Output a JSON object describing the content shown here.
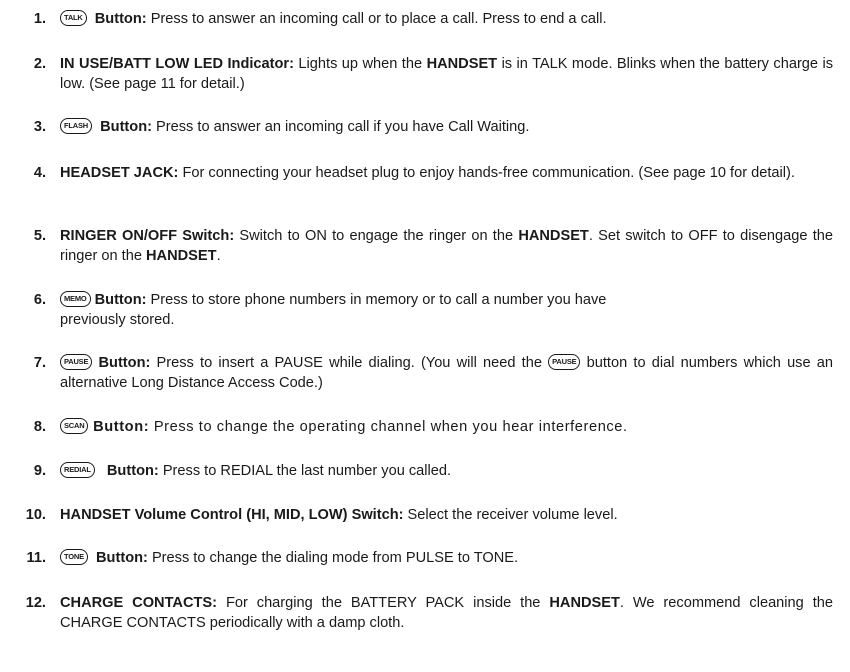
{
  "items": [
    {
      "num": "1.",
      "key": "TALK",
      "title": "Button:",
      "text": "Press to answer an incoming call or to place a call. Press to end a call."
    },
    {
      "num": "2.",
      "title": "IN USE/BATT LOW LED Indicator:",
      "text_a": "Lights up when the",
      "bold_a": "HANDSET",
      "text_b": "is in TALK mode. Blinks when the battery charge is low. (See page 11 for detail.)"
    },
    {
      "num": "3.",
      "key": "FLASH",
      "title": "Button:",
      "text": "Press to answer an incoming call if you have Call Waiting."
    },
    {
      "num": "4.",
      "title": "HEADSET JACK:",
      "text": "For connecting your headset plug to enjoy hands-free communication. (See page 10 for detail)."
    },
    {
      "num": "5.",
      "title": "RINGER ON/OFF Switch:",
      "text_a": "Switch to ON to engage the ringer on the",
      "bold_a": "HANDSET",
      "text_b": ". Set switch to OFF to disengage the ringer on the",
      "bold_b": "HANDSET",
      "text_c": "."
    },
    {
      "num": "6.",
      "key": "MEMO",
      "title": "Button:",
      "text_a": "Press to store phone numbers in memory or to call a number you have",
      "text_b": "previously stored."
    },
    {
      "num": "7.",
      "key": "PAUSE",
      "title": "Button:",
      "text_a": "Press to insert a PAUSE while dialing. (You will need the",
      "key2": "PAUSE",
      "text_b": "button to dial numbers which use an alternative Long Distance Access Code.)"
    },
    {
      "num": "8.",
      "key": "SCAN",
      "title": "Button:",
      "text": "Press to change the operating channel when you hear interference."
    },
    {
      "num": "9.",
      "key": "REDIAL",
      "title": "Button:",
      "text": "Press to REDIAL  the last number you called."
    },
    {
      "num": "10.",
      "title": "HANDSET Volume Control (HI, MID, LOW) Switch:",
      "text": "Select the receiver volume level."
    },
    {
      "num": "11.",
      "key": "TONE",
      "title": "Button:",
      "text": "Press to change the dialing mode from PULSE to TONE."
    },
    {
      "num": "12.",
      "title": "CHARGE CONTACTS:",
      "text_a": "For charging the BATTERY PACK inside the",
      "bold_a": "HANDSET",
      "text_b": ". We recommend cleaning the CHARGE CONTACTS periodically with a damp cloth."
    }
  ]
}
